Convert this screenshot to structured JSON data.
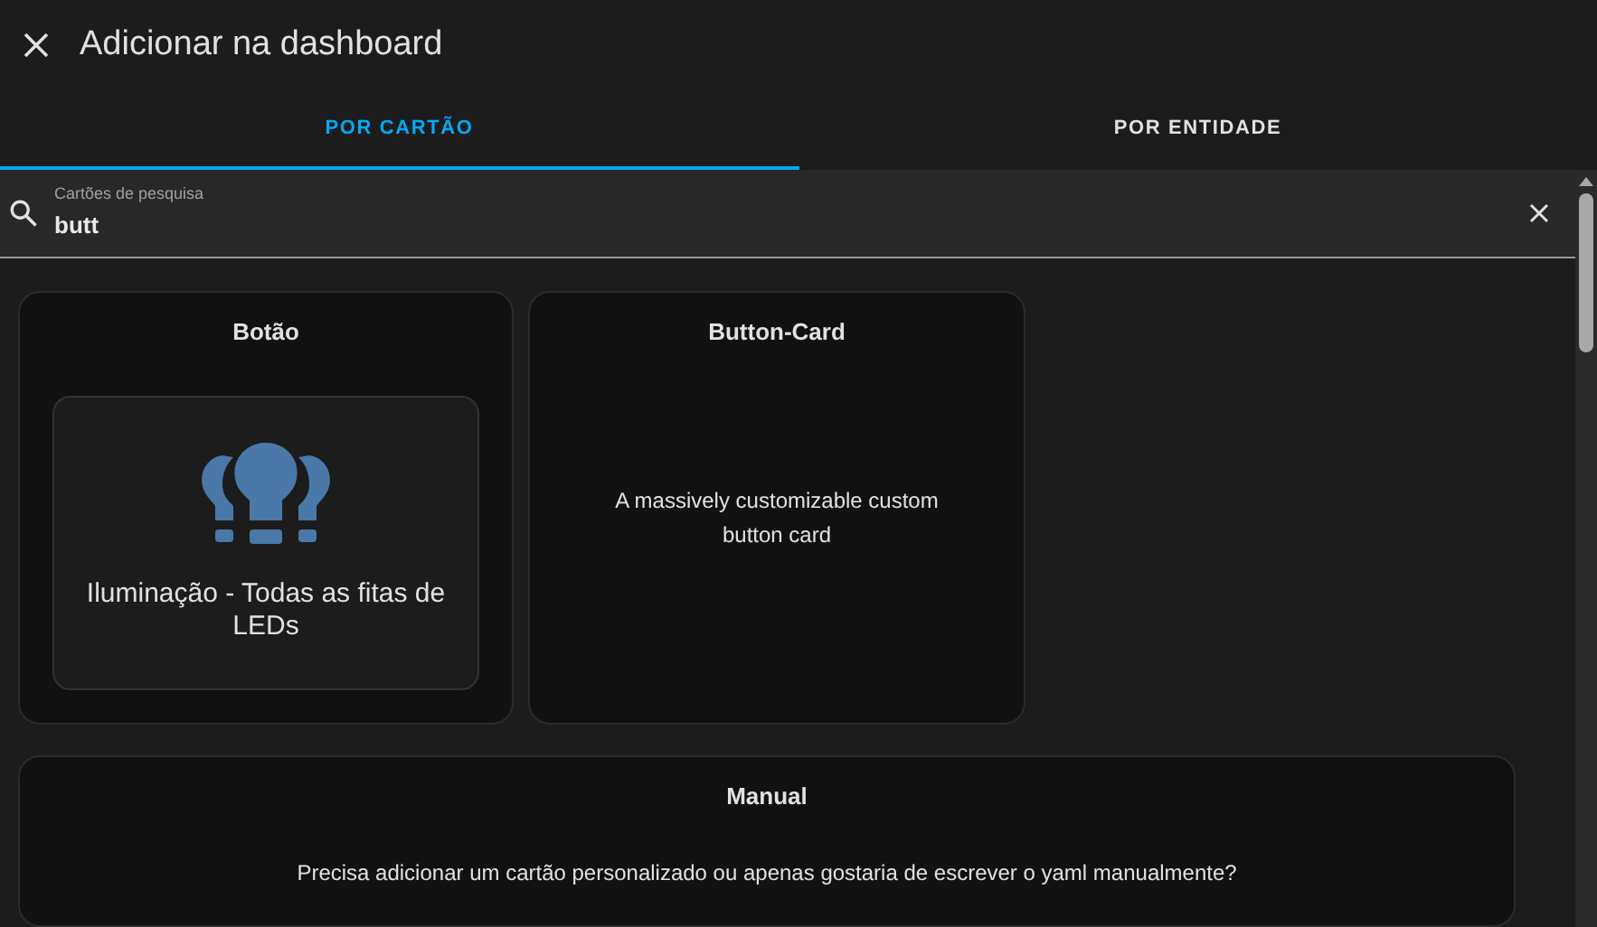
{
  "dialog": {
    "title": "Adicionar na dashboard"
  },
  "tabs": [
    {
      "label": "POR CARTÃO",
      "selected": true
    },
    {
      "label": "POR ENTIDADE",
      "selected": false
    }
  ],
  "search": {
    "label": "Cartões de pesquisa",
    "value": "butt"
  },
  "cards": [
    {
      "kind": "preview",
      "title": "Botão",
      "preview_label": "Iluminação - Todas as fitas de LEDs"
    },
    {
      "kind": "description",
      "title": "Button-Card",
      "description": "A massively customizable custom button card"
    }
  ],
  "manual": {
    "title": "Manual",
    "description": "Precisa adicionar um cartão personalizado ou apenas gostaria de escrever o yaml manualmente?"
  }
}
